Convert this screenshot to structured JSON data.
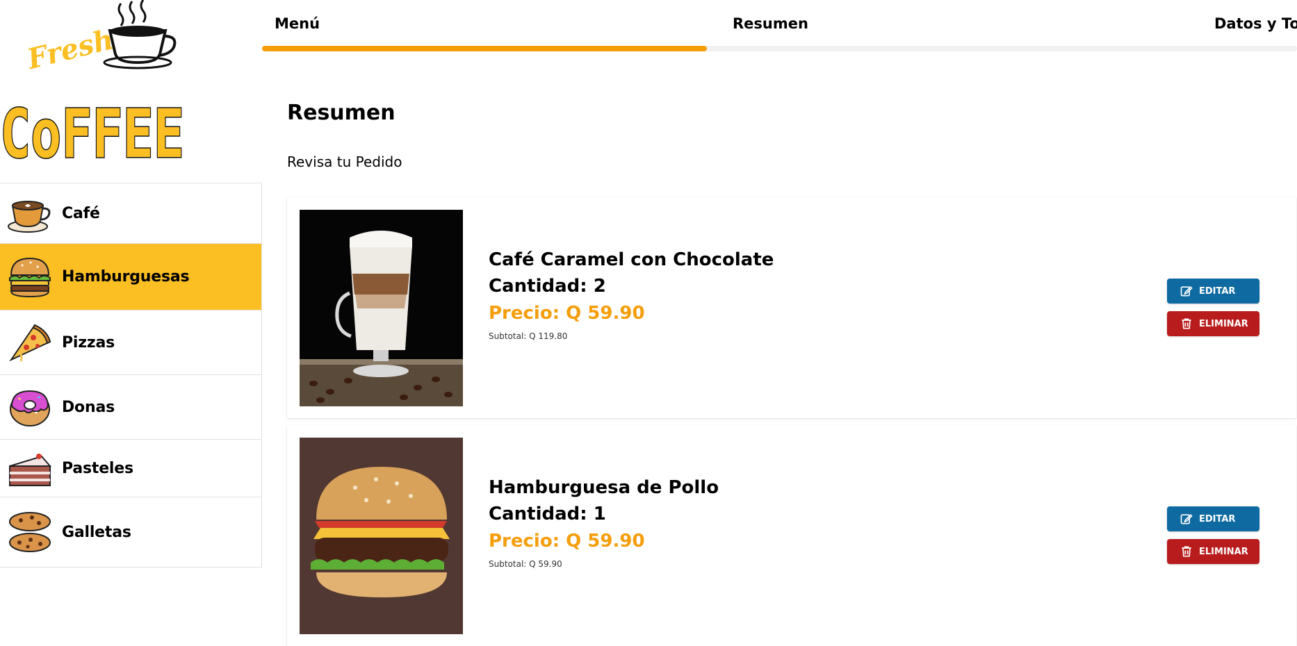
{
  "logo": {
    "line1": "Fresh",
    "line2": "CoFFEE"
  },
  "categories": [
    {
      "label": "Café",
      "icon": "coffee-cup-icon",
      "active": false
    },
    {
      "label": "Hamburguesas",
      "icon": "burger-icon",
      "active": true
    },
    {
      "label": "Pizzas",
      "icon": "pizza-slice-icon",
      "active": false
    },
    {
      "label": "Donas",
      "icon": "donut-icon",
      "active": false
    },
    {
      "label": "Pasteles",
      "icon": "cake-slice-icon",
      "active": false
    },
    {
      "label": "Galletas",
      "icon": "cookies-icon",
      "active": false
    }
  ],
  "steps": [
    {
      "label": "Menú"
    },
    {
      "label": "Resumen"
    },
    {
      "label": "Datos y Total"
    }
  ],
  "progress": 0.5,
  "main": {
    "title": "Resumen",
    "subtitle": "Revisa tu Pedido",
    "items": [
      {
        "name": "Café Caramel con Chocolate",
        "quantity": "Cantidad: 2",
        "price": "Precio: Q 59.90",
        "subtotal": "Subtotal: Q 119.80",
        "image": "layered-coffee-glass-photo",
        "edit_label": "EDITAR",
        "delete_label": "ELIMINAR"
      },
      {
        "name": "Hamburguesa de Pollo",
        "quantity": "Cantidad: 1",
        "price": "Precio: Q 59.90",
        "subtotal": "Subtotal: Q 59.90",
        "image": "chicken-burger-photo",
        "edit_label": "EDITAR",
        "delete_label": "ELIMINAR"
      }
    ]
  },
  "colors": {
    "accent": "#f59e0b",
    "active_category": "#fbbf24",
    "edit_button": "#0e6aa0",
    "delete_button": "#b91c1c"
  }
}
